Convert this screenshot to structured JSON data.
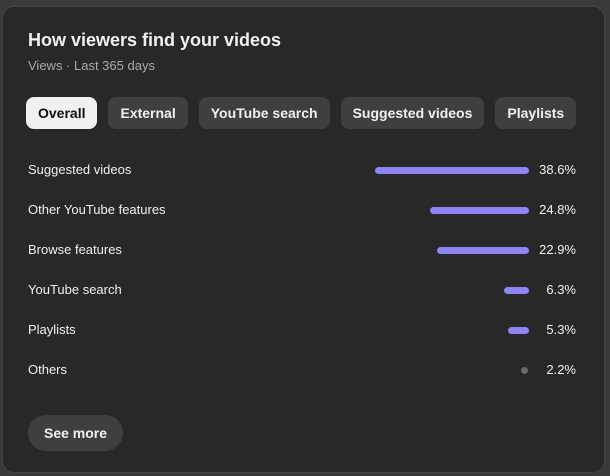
{
  "card": {
    "title": "How viewers find your videos",
    "subtitle": "Views · Last 365 days"
  },
  "tabs": [
    {
      "label": "Overall",
      "active": true
    },
    {
      "label": "External",
      "active": false
    },
    {
      "label": "YouTube search",
      "active": false
    },
    {
      "label": "Suggested videos",
      "active": false
    },
    {
      "label": "Playlists",
      "active": false
    }
  ],
  "sources": [
    {
      "label": "Suggested videos",
      "value": "38.6%",
      "percent": 38.6
    },
    {
      "label": "Other YouTube features",
      "value": "24.8%",
      "percent": 24.8
    },
    {
      "label": "Browse features",
      "value": "22.9%",
      "percent": 22.9
    },
    {
      "label": "YouTube search",
      "value": "6.3%",
      "percent": 6.3
    },
    {
      "label": "Playlists",
      "value": "5.3%",
      "percent": 5.3
    },
    {
      "label": "Others",
      "value": "2.2%",
      "percent": 2.2
    }
  ],
  "see_more_label": "See more",
  "colors": {
    "bar": "#8e85f2",
    "others_dot": "#6a6a6a",
    "card_bg": "#282828"
  }
}
